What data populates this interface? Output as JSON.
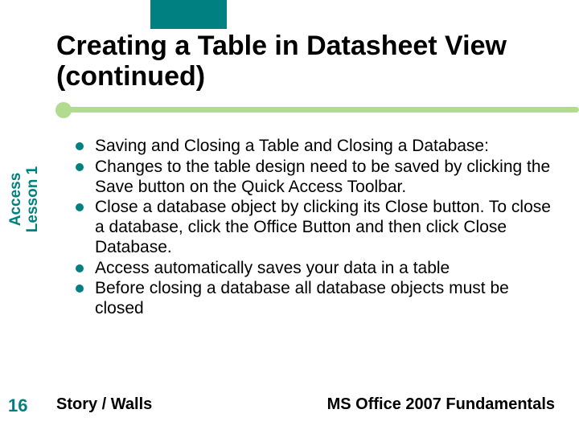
{
  "title": "Creating a Table in Datasheet View (continued)",
  "sidebar": {
    "line1": "Access",
    "line2": "Lesson 1"
  },
  "page_number": "16",
  "bullets": {
    "b0": "Saving and Closing a Table and Closing a Database:",
    "b1": "Changes to the table design need to be saved by clicking the Save button on the Quick Access Toolbar.",
    "b2": "Close a database object by clicking its Close button. To close a database, click the Office Button and then click Close Database.",
    "b3": "Access automatically saves your data in a table",
    "b4": "Before closing a database all database objects must be closed"
  },
  "footer": {
    "left": "Story / Walls",
    "right": "MS Office 2007 Fundamentals"
  }
}
